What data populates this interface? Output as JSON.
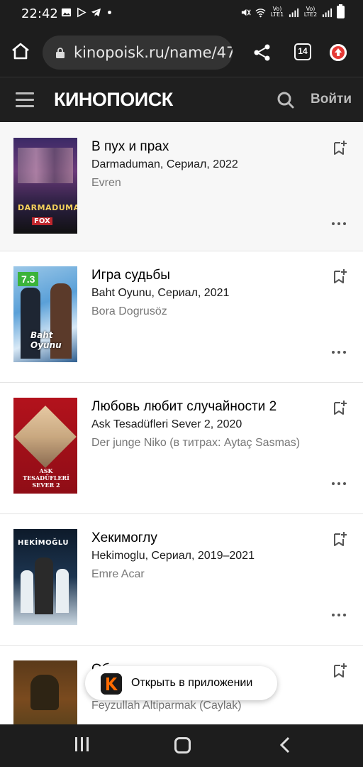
{
  "status_bar": {
    "time": "22:42",
    "sim1": "Vo) LTE1",
    "sim2": "Vo) LTE2"
  },
  "browser": {
    "url": "kinopoisk.ru/name/47",
    "tab_count": "14"
  },
  "site_header": {
    "logo": "КИНОПОИСК",
    "login": "Войти"
  },
  "films": [
    {
      "title": "В пух и прах",
      "subtitle": "Darmaduman, Сериал, 2022",
      "role": "Evren",
      "poster_text": "DARMADUMAN",
      "poster_badge": "FOX",
      "rating": ""
    },
    {
      "title": "Игра судьбы",
      "subtitle": "Baht Oyunu, Сериал, 2021",
      "role": "Bora Dogrusöz",
      "poster_text": "Baht Oyunu",
      "poster_badge": "",
      "rating": "7.3"
    },
    {
      "title": "Любовь любит случайности 2",
      "subtitle": "Ask Tesadüfleri Sever 2, 2020",
      "role": "Der junge Niko (в титрах: Aytaç Sasmas)",
      "poster_text": "ASK TESADÜFLERİ SEVER 2",
      "poster_badge": "",
      "rating": ""
    },
    {
      "title": "Хекимоглу",
      "subtitle": "Hekimoglu, Сериал, 2019–2021",
      "role": "Emre Acar",
      "poster_text": "HEKİMOĞLU",
      "poster_badge": "",
      "rating": ""
    },
    {
      "title": "Об",
      "subtitle": "",
      "role": "Feyzullah Altiparmak (Caylak)",
      "poster_text": "",
      "poster_badge": "",
      "rating": ""
    }
  ],
  "open_app": {
    "label": "Открыть в приложении"
  },
  "colors": {
    "rating_green": "#3bb33b",
    "dark_bar": "#1d1d1d",
    "accent_orange": "#ff6b00"
  }
}
